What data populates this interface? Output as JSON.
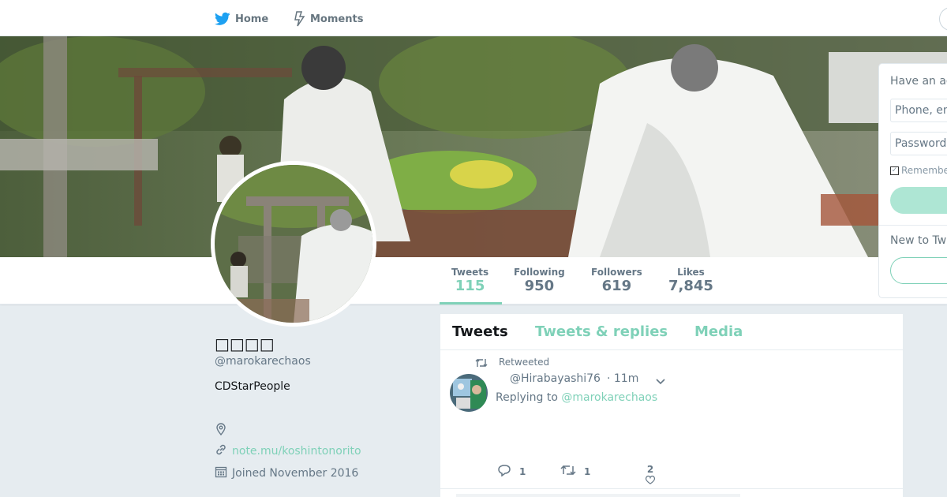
{
  "nav": {
    "home_label": "Home",
    "moments_label": "Moments",
    "brand_icon": "bird-icon",
    "moments_icon": "lightning-icon"
  },
  "profile": {
    "name": "□□□□",
    "handle": "@marokarechaos",
    "bio": "CDStarPeople",
    "url": "note.mu/koshintonorito",
    "joined": "Joined November 2016",
    "stats": [
      {
        "label": "Tweets",
        "value": "115"
      },
      {
        "label": "Following",
        "value": "950"
      },
      {
        "label": "Followers",
        "value": "619"
      },
      {
        "label": "Likes",
        "value": "7,845"
      }
    ]
  },
  "timeline": {
    "tabs": [
      "Tweets",
      "Tweets & replies",
      "Media"
    ],
    "tweet": {
      "retweeted_label": "Retweeted",
      "handle": "@Hirabayashi76",
      "time": "· 11m",
      "replying_to_prefix": "Replying to",
      "replying_to_handle": "@marokarechaos",
      "reply_count": "1",
      "retweet_count": "1",
      "like_count": "2"
    }
  },
  "login": {
    "title": "Have an ac",
    "phone_placeholder": "Phone, em",
    "password_placeholder": "Password",
    "remember_label": "Remembe",
    "new_label": "New to Tw"
  },
  "colors": {
    "accent": "#7fd1b8",
    "brand_blue": "#1da1f2",
    "text_gray": "#657786",
    "background": "#e6ecf0"
  }
}
